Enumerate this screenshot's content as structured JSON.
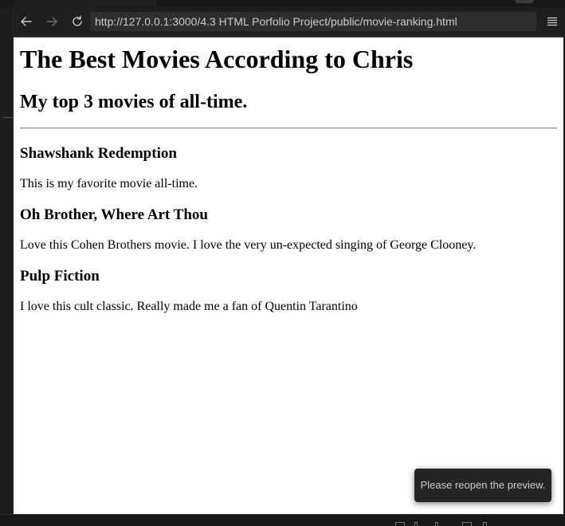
{
  "browser": {
    "url": "http://127.0.0.1:3000/4.3 HTML Porfolio Project/public/movie-ranking.html"
  },
  "page": {
    "heading": "The Best Movies According to Chris",
    "subheading": "My top 3 movies of all-time.",
    "movies": [
      {
        "title": "Shawshank Redemption",
        "description": "This is my favorite movie all-time."
      },
      {
        "title": "Oh Brother, Where Art Thou",
        "description": "Love this Cohen Brothers movie. I love the very un-expected singing of George Clooney."
      },
      {
        "title": "Pulp Fiction",
        "description": "I love this cult classic. Really made me a fan of Quentin Tarantino"
      }
    ]
  },
  "toast": {
    "message": "Please reopen the preview."
  },
  "colors": {
    "toolbar_bg": "#1f1f1f",
    "url_bg": "#2e2e2e",
    "page_bg": "#ffffff",
    "toast_bg": "#252526"
  }
}
